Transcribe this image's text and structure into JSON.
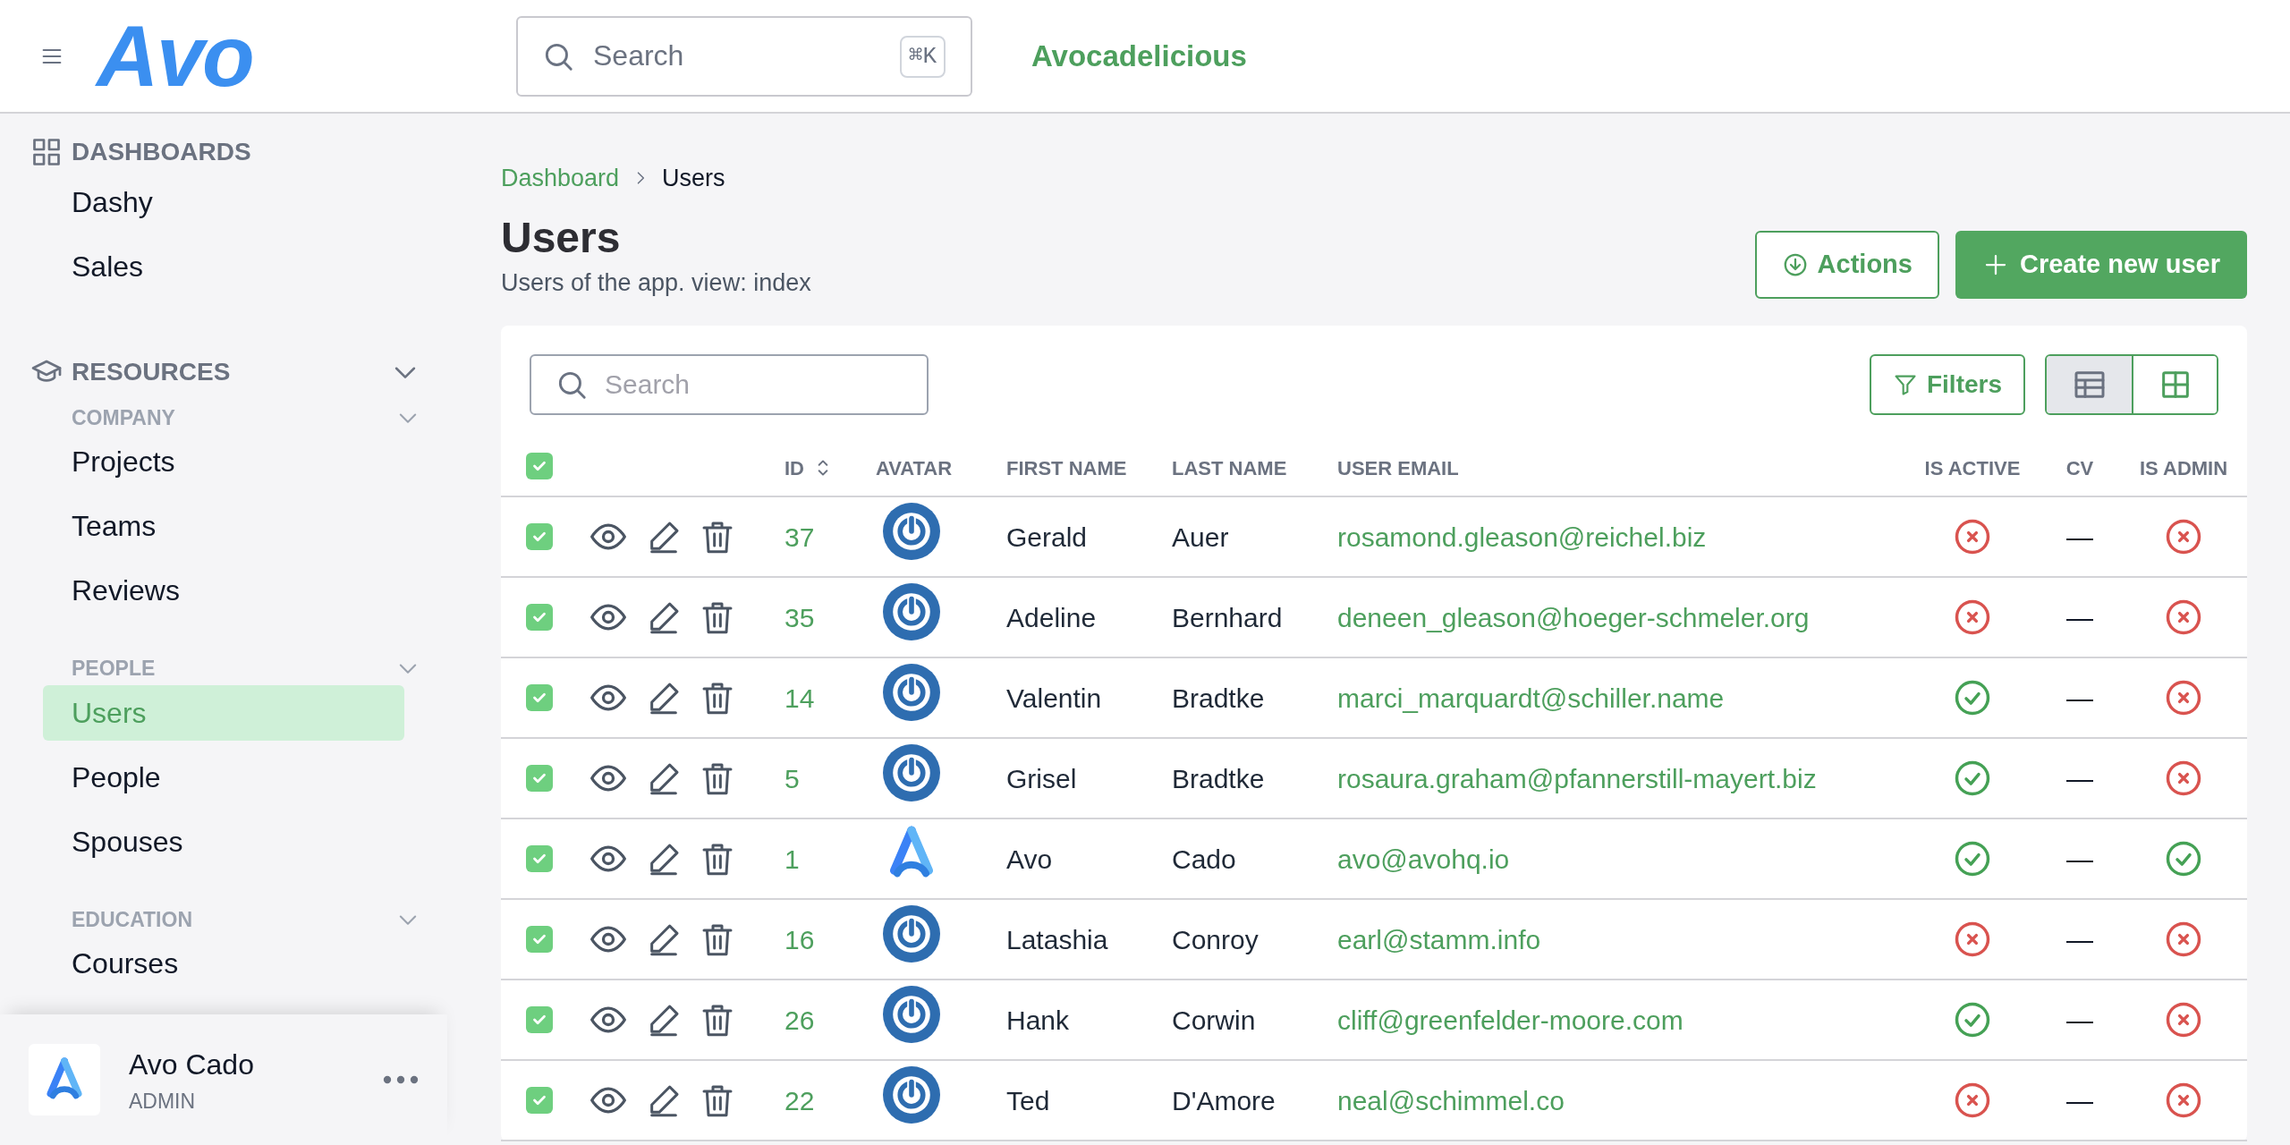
{
  "header": {
    "logo_text": "Avo",
    "search": {
      "placeholder": "Search",
      "shortcut": "⌘K"
    },
    "app_name": "Avocadelicious"
  },
  "sidebar": {
    "sections": [
      {
        "kind": "dashboards",
        "title": "DASHBOARDS",
        "items": [
          {
            "label": "Dashy",
            "selected": false
          },
          {
            "label": "Sales",
            "selected": false
          }
        ]
      },
      {
        "kind": "resources",
        "title": "RESOURCES",
        "expanded": true,
        "groups": [
          {
            "title": "COMPANY",
            "expanded": true,
            "items": [
              {
                "label": "Projects",
                "selected": false
              },
              {
                "label": "Teams",
                "selected": false
              },
              {
                "label": "Reviews",
                "selected": false
              }
            ]
          },
          {
            "title": "PEOPLE",
            "expanded": true,
            "items": [
              {
                "label": "Users",
                "selected": true
              },
              {
                "label": "People",
                "selected": false
              },
              {
                "label": "Spouses",
                "selected": false
              }
            ]
          },
          {
            "title": "EDUCATION",
            "expanded": true,
            "items": [
              {
                "label": "Courses",
                "selected": false
              }
            ]
          }
        ]
      }
    ],
    "user": {
      "name": "Avo Cado",
      "role": "ADMIN"
    }
  },
  "breadcrumb": [
    "Dashboard",
    "Users"
  ],
  "page": {
    "title": "Users",
    "subtitle": "Users of the app. view: index",
    "actions": [
      "Actions",
      "Create new user"
    ]
  },
  "table": {
    "search": {
      "placeholder": "Search"
    },
    "filters": "Filters",
    "views": [
      {
        "kind": "table",
        "selected": true
      },
      {
        "kind": "grid",
        "selected": false
      }
    ],
    "select_all": true,
    "columns": [
      {
        "label": "ID",
        "sortable": true
      },
      {
        "label": "AVATAR",
        "sortable": false
      },
      {
        "label": "FIRST NAME",
        "sortable": false
      },
      {
        "label": "LAST NAME",
        "sortable": false
      },
      {
        "label": "USER EMAIL",
        "sortable": false
      },
      {
        "label": "IS ACTIVE",
        "sortable": false
      },
      {
        "label": "CV",
        "sortable": false
      },
      {
        "label": "IS ADMIN",
        "sortable": false
      }
    ],
    "rows": [
      {
        "selected": true,
        "id": "37",
        "avatar": {
          "kind": "power"
        },
        "first_name": "Gerald",
        "last_name": "Auer",
        "email": "rosamond.gleason@reichel.biz",
        "is_active": false,
        "cv": "—",
        "is_admin": false
      },
      {
        "selected": true,
        "id": "35",
        "avatar": {
          "kind": "power"
        },
        "first_name": "Adeline",
        "last_name": "Bernhard",
        "email": "deneen_gleason@hoeger-schmeler.org",
        "is_active": false,
        "cv": "—",
        "is_admin": false
      },
      {
        "selected": true,
        "id": "14",
        "avatar": {
          "kind": "power"
        },
        "first_name": "Valentin",
        "last_name": "Bradtke",
        "email": "marci_marquardt@schiller.name",
        "is_active": true,
        "cv": "—",
        "is_admin": false
      },
      {
        "selected": true,
        "id": "5",
        "avatar": {
          "kind": "power"
        },
        "first_name": "Grisel",
        "last_name": "Bradtke",
        "email": "rosaura.graham@pfannerstill-mayert.biz",
        "is_active": true,
        "cv": "—",
        "is_admin": false
      },
      {
        "selected": true,
        "id": "1",
        "avatar": {
          "kind": "avo"
        },
        "first_name": "Avo",
        "last_name": "Cado",
        "email": "avo@avohq.io",
        "is_active": true,
        "cv": "—",
        "is_admin": true
      },
      {
        "selected": true,
        "id": "16",
        "avatar": {
          "kind": "power"
        },
        "first_name": "Latashia",
        "last_name": "Conroy",
        "email": "earl@stamm.info",
        "is_active": false,
        "cv": "—",
        "is_admin": false
      },
      {
        "selected": true,
        "id": "26",
        "avatar": {
          "kind": "power"
        },
        "first_name": "Hank",
        "last_name": "Corwin",
        "email": "cliff@greenfelder-moore.com",
        "is_active": true,
        "cv": "—",
        "is_admin": false
      },
      {
        "selected": true,
        "id": "22",
        "avatar": {
          "kind": "power"
        },
        "first_name": "Ted",
        "last_name": "D'Amore",
        "email": "neal@schimmel.co",
        "is_active": false,
        "cv": "—",
        "is_admin": false
      }
    ]
  }
}
